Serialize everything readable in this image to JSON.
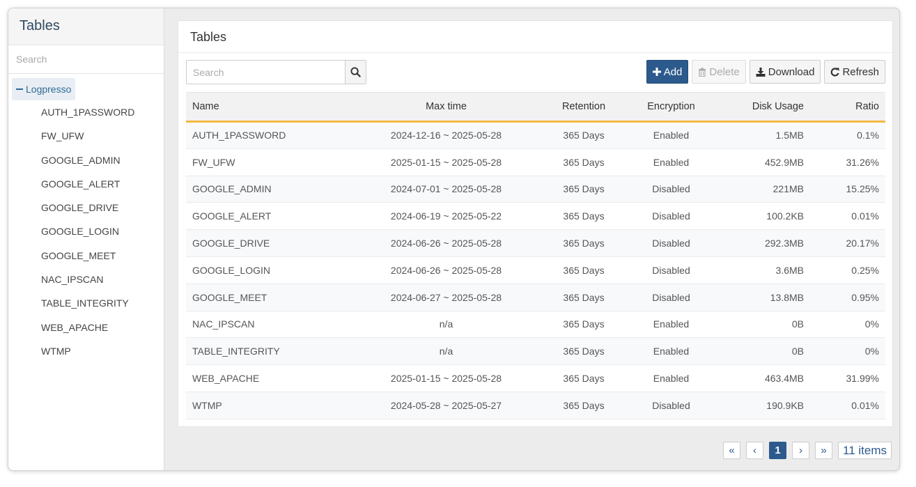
{
  "sidebar": {
    "title": "Tables",
    "search_placeholder": "Search",
    "root": "Logpresso",
    "items": [
      "AUTH_1PASSWORD",
      "FW_UFW",
      "GOOGLE_ADMIN",
      "GOOGLE_ALERT",
      "GOOGLE_DRIVE",
      "GOOGLE_LOGIN",
      "GOOGLE_MEET",
      "NAC_IPSCAN",
      "TABLE_INTEGRITY",
      "WEB_APACHE",
      "WTMP"
    ]
  },
  "panel": {
    "title": "Tables",
    "search_placeholder": "Search",
    "buttons": {
      "add": "Add",
      "delete": "Delete",
      "download": "Download",
      "refresh": "Refresh"
    }
  },
  "table": {
    "columns": [
      "Name",
      "Max time",
      "Retention",
      "Encryption",
      "Disk Usage",
      "Ratio"
    ],
    "rows": [
      [
        "AUTH_1PASSWORD",
        "2024-12-16 ~ 2025-05-28",
        "365 Days",
        "Enabled",
        "1.5MB",
        "0.1%"
      ],
      [
        "FW_UFW",
        "2025-01-15 ~ 2025-05-28",
        "365 Days",
        "Enabled",
        "452.9MB",
        "31.26%"
      ],
      [
        "GOOGLE_ADMIN",
        "2024-07-01 ~ 2025-05-28",
        "365 Days",
        "Disabled",
        "221MB",
        "15.25%"
      ],
      [
        "GOOGLE_ALERT",
        "2024-06-19 ~ 2025-05-22",
        "365 Days",
        "Disabled",
        "100.2KB",
        "0.01%"
      ],
      [
        "GOOGLE_DRIVE",
        "2024-06-26 ~ 2025-05-28",
        "365 Days",
        "Disabled",
        "292.3MB",
        "20.17%"
      ],
      [
        "GOOGLE_LOGIN",
        "2024-06-26 ~ 2025-05-28",
        "365 Days",
        "Disabled",
        "3.6MB",
        "0.25%"
      ],
      [
        "GOOGLE_MEET",
        "2024-06-27 ~ 2025-05-28",
        "365 Days",
        "Disabled",
        "13.8MB",
        "0.95%"
      ],
      [
        "NAC_IPSCAN",
        "n/a",
        "365 Days",
        "Enabled",
        "0B",
        "0%"
      ],
      [
        "TABLE_INTEGRITY",
        "n/a",
        "365 Days",
        "Enabled",
        "0B",
        "0%"
      ],
      [
        "WEB_APACHE",
        "2025-01-15 ~ 2025-05-28",
        "365 Days",
        "Enabled",
        "463.4MB",
        "31.99%"
      ],
      [
        "WTMP",
        "2024-05-28 ~ 2025-05-27",
        "365 Days",
        "Disabled",
        "190.9KB",
        "0.01%"
      ]
    ]
  },
  "pager": {
    "first": "«",
    "prev": "‹",
    "current": "1",
    "next": "›",
    "last": "»",
    "count": "11 items"
  },
  "colors": {
    "primary": "#2c5a8c",
    "header_accent": "#f4b942"
  }
}
